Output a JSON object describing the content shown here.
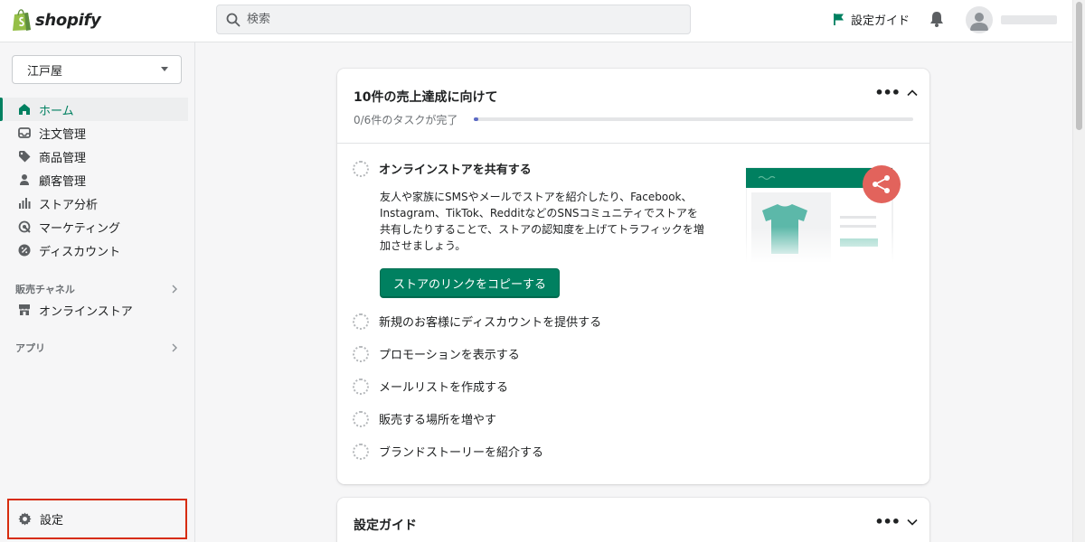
{
  "app": {
    "brand": "shopify"
  },
  "search": {
    "placeholder": "検索"
  },
  "topbar": {
    "guide_label": "設定ガイド"
  },
  "sidebar": {
    "store_name": "江戸屋",
    "items": [
      {
        "label": "ホーム",
        "icon": "home-icon"
      },
      {
        "label": "注文管理",
        "icon": "inbox-icon"
      },
      {
        "label": "商品管理",
        "icon": "tag-icon"
      },
      {
        "label": "顧客管理",
        "icon": "person-icon"
      },
      {
        "label": "ストア分析",
        "icon": "bar-chart-icon"
      },
      {
        "label": "マーケティング",
        "icon": "target-icon"
      },
      {
        "label": "ディスカウント",
        "icon": "discount-icon"
      }
    ],
    "sales_channels_label": "販売チャネル",
    "online_store_label": "オンラインストア",
    "apps_label": "アプリ",
    "settings_label": "設定"
  },
  "main": {
    "card1": {
      "title": "10件の売上達成に向けて",
      "progress_text": "0/6件のタスクが完了",
      "progress": 0,
      "open_task": {
        "title": "オンラインストアを共有する",
        "description": "友人や家族にSMSやメールでストアを紹介したり、Facebook、Instagram、TikTok、RedditなどのSNSコミュニティでストアを共有したりすることで、ストアの認知度を上げてトラフィックを増加させましょう。",
        "button": "ストアのリンクをコピーする"
      },
      "tasks": [
        "新規のお客様にディスカウントを提供する",
        "プロモーションを表示する",
        "メールリストを作成する",
        "販売する場所を増やす",
        "ブランドストーリーを紹介する"
      ]
    },
    "card2": {
      "title": "設定ガイド"
    }
  },
  "colors": {
    "accent": "#008060",
    "danger": "#d72c0d",
    "share": "#e2635c"
  }
}
